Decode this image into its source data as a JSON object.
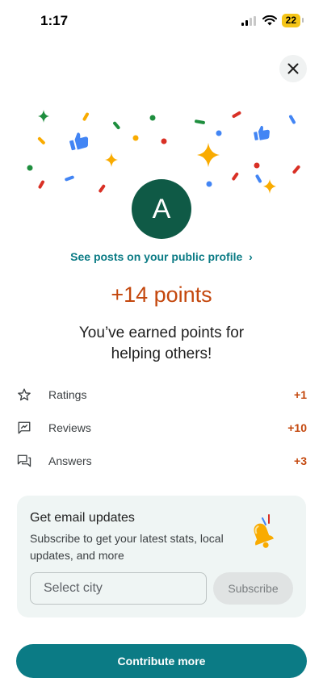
{
  "status_bar": {
    "time": "1:17",
    "battery": "22"
  },
  "profile": {
    "avatar_letter": "A",
    "link_label": "See posts on your public profile",
    "link_chevron": "›"
  },
  "reward": {
    "points": "+14 points",
    "message": "You’ve earned points for helping others!"
  },
  "stats": [
    {
      "label": "Ratings",
      "value": "+1",
      "icon": "star-outline-icon"
    },
    {
      "label": "Reviews",
      "value": "+10",
      "icon": "review-icon"
    },
    {
      "label": "Answers",
      "value": "+3",
      "icon": "answers-icon"
    }
  ],
  "email": {
    "title": "Get email updates",
    "subtitle": "Subscribe to get your latest stats, local updates, and more",
    "city_placeholder": "Select city",
    "subscribe_label": "Subscribe"
  },
  "cta": {
    "label": "Contribute more"
  },
  "colors": {
    "accent": "#0b7b85",
    "points": "#c4480e",
    "avatar_bg": "#0f5a46",
    "card_bg": "#eff5f4"
  }
}
